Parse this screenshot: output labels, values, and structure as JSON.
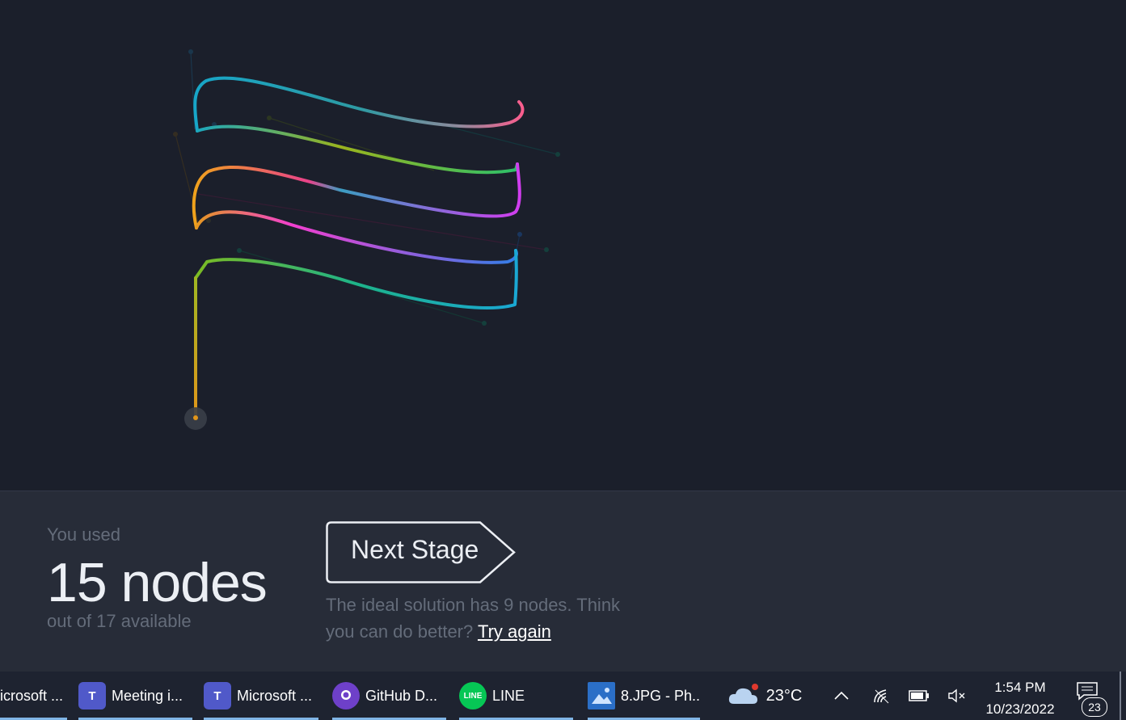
{
  "results": {
    "used_label": "You used",
    "used_count": "15 nodes",
    "available_label": "out of 17 available",
    "next_button": "Next Stage",
    "hint_text": "The ideal solution has 9 nodes. Think you can do better?",
    "retry_link": "Try again"
  },
  "taskbar": {
    "apps": [
      {
        "label": "icrosoft ...",
        "icon": "edge-icon"
      },
      {
        "label": "Meeting i...",
        "icon": "teams-icon"
      },
      {
        "label": "Microsoft ...",
        "icon": "teams-icon"
      },
      {
        "label": "GitHub D...",
        "icon": "github-icon"
      },
      {
        "label": "LINE",
        "icon": "line-icon"
      },
      {
        "label": "8.JPG - Ph...",
        "icon": "photos-icon"
      }
    ],
    "icon_text": {
      "teams": "T",
      "line": "LINE"
    },
    "weather": "23°C",
    "time": "1:54 PM",
    "date": "10/23/2022",
    "notifications": "23"
  },
  "colors": {
    "background": "#1b1f2b",
    "panel": "#272c38",
    "accent": "#80b5e6"
  }
}
